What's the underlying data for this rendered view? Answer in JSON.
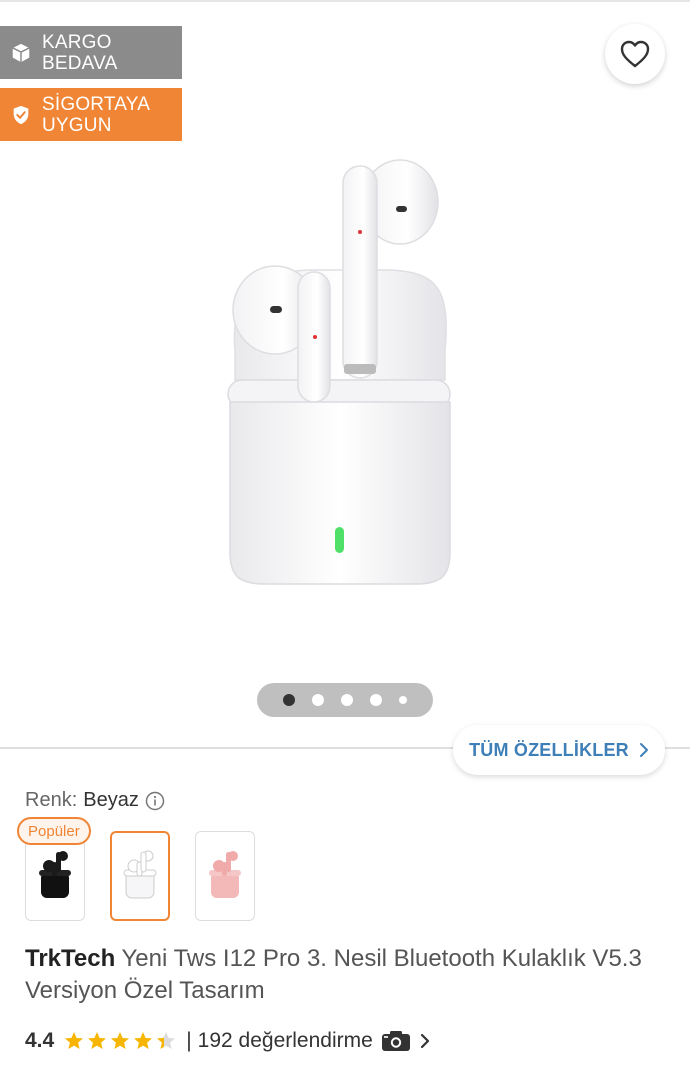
{
  "badges": {
    "cargo_line1": "KARGO",
    "cargo_line2": "BEDAVA",
    "insurance_line1": "SİGORTAYA",
    "insurance_line2": "UYGUN"
  },
  "gallery": {
    "slide_count": 5,
    "active_slide": 1
  },
  "all_specs_label": "TÜM ÖZELLİKLER",
  "color": {
    "label": "Renk:",
    "value": "Beyaz",
    "popular_label": "Popüler",
    "options": [
      "Siyah",
      "Beyaz",
      "Pembe"
    ],
    "selected_index": 1
  },
  "product": {
    "brand": "TrkTech",
    "name": " Yeni Tws I12 Pro 3. Nesil Bluetooth Kulaklık V5.3 Versiyon Özel Tasarım"
  },
  "rating": {
    "score": "4.4",
    "stars_filled_fraction": 0.88,
    "separator": "|",
    "reviews": "192 değerlendirme"
  },
  "colors": {
    "cargo_badge": "#8b8b8b",
    "insurance_badge": "#f08535",
    "accent_orange": "#f08535",
    "link_blue": "#3f7fb8",
    "star": "#f7b500"
  },
  "icons": [
    "box-icon",
    "shield-check-icon",
    "heart-icon",
    "chevron-right-icon",
    "info-icon",
    "star-icon",
    "camera-icon"
  ]
}
